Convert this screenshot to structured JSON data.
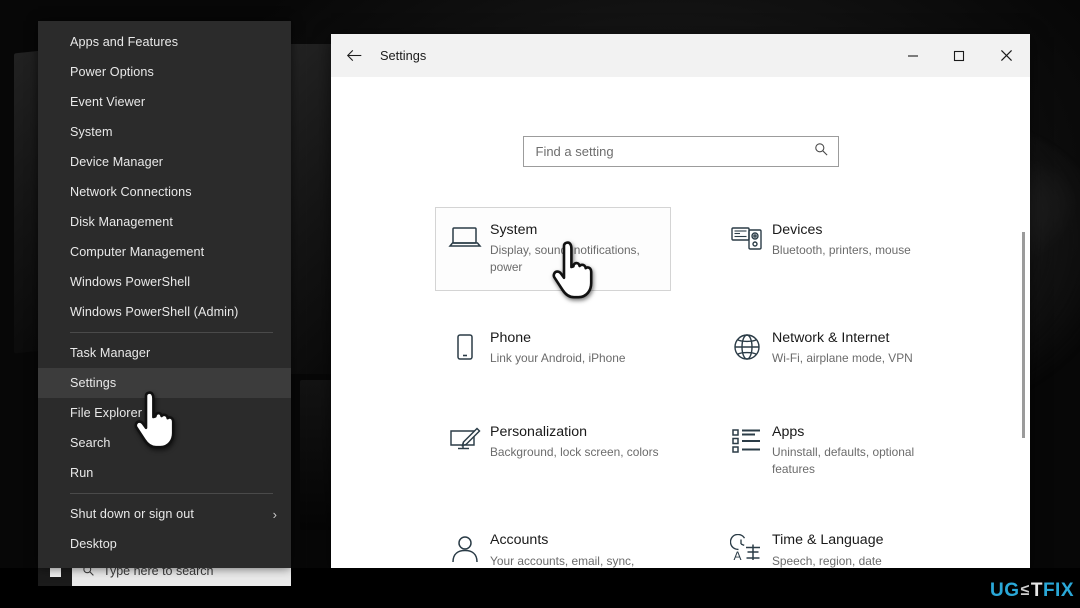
{
  "desktop": {
    "taskbar": {
      "start_icon": "windows-start-icon",
      "search_icon": "search-icon",
      "search_placeholder": "Type here to search"
    }
  },
  "context_menu": {
    "name": "winx-quick-link-menu",
    "items": [
      {
        "label": "Apps and Features",
        "selected": false,
        "submenu": false
      },
      {
        "label": "Power Options",
        "selected": false,
        "submenu": false
      },
      {
        "label": "Event Viewer",
        "selected": false,
        "submenu": false
      },
      {
        "label": "System",
        "selected": false,
        "submenu": false
      },
      {
        "label": "Device Manager",
        "selected": false,
        "submenu": false
      },
      {
        "label": "Network Connections",
        "selected": false,
        "submenu": false
      },
      {
        "label": "Disk Management",
        "selected": false,
        "submenu": false
      },
      {
        "label": "Computer Management",
        "selected": false,
        "submenu": false
      },
      {
        "label": "Windows PowerShell",
        "selected": false,
        "submenu": false
      },
      {
        "label": "Windows PowerShell (Admin)",
        "selected": false,
        "submenu": false
      },
      {
        "separator": true
      },
      {
        "label": "Task Manager",
        "selected": false,
        "submenu": false
      },
      {
        "label": "Settings",
        "selected": true,
        "submenu": false
      },
      {
        "label": "File Explorer",
        "selected": false,
        "submenu": false
      },
      {
        "label": "Search",
        "selected": false,
        "submenu": false
      },
      {
        "label": "Run",
        "selected": false,
        "submenu": false
      },
      {
        "separator": true
      },
      {
        "label": "Shut down or sign out",
        "selected": false,
        "submenu": true,
        "chevron": "›"
      },
      {
        "label": "Desktop",
        "selected": false,
        "submenu": false
      }
    ]
  },
  "settings_window": {
    "titlebar": {
      "back_icon": "back-arrow-icon",
      "title": "Settings",
      "minimize_label": "─",
      "maximize_label": "□",
      "close_label": "✕"
    },
    "search": {
      "placeholder": "Find a setting",
      "icon": "search-icon"
    },
    "tiles": [
      {
        "icon": "laptop-icon",
        "title": "System",
        "subtitle": "Display, sound, notifications, power",
        "hover": true
      },
      {
        "icon": "devices-icon",
        "title": "Devices",
        "subtitle": "Bluetooth, printers, mouse",
        "hover": false
      },
      {
        "icon": "phone-icon",
        "title": "Phone",
        "subtitle": "Link your Android, iPhone",
        "hover": false
      },
      {
        "icon": "globe-icon",
        "title": "Network & Internet",
        "subtitle": "Wi-Fi, airplane mode, VPN",
        "hover": false
      },
      {
        "icon": "personalization-brush-icon",
        "title": "Personalization",
        "subtitle": "Background, lock screen, colors",
        "hover": false
      },
      {
        "icon": "apps-list-icon",
        "title": "Apps",
        "subtitle": "Uninstall, defaults, optional features",
        "hover": false
      },
      {
        "icon": "person-icon",
        "title": "Accounts",
        "subtitle": "Your accounts, email, sync, work, family",
        "hover": false
      },
      {
        "icon": "clock-language-icon",
        "title": "Time & Language",
        "subtitle": "Speech, region, date",
        "hover": false
      }
    ],
    "scrollbar": {
      "name": "vertical-scrollbar"
    }
  },
  "cursors": [
    {
      "name": "hand-pointer-cursor-on-system-tile"
    },
    {
      "name": "hand-pointer-cursor-on-settings-menu-item"
    }
  ],
  "watermark": {
    "part_a": "UG",
    "part_e": "≤",
    "part_t": "T",
    "part_b": "FIX"
  },
  "colors": {
    "menu_bg": "#2b2b2b",
    "menu_selected": "#3c3c3c",
    "titlebar_bg": "#f2f2f2",
    "window_bg": "#ffffff",
    "icon_color": "#2b3c47",
    "accent_blue": "#2aa8d8"
  }
}
